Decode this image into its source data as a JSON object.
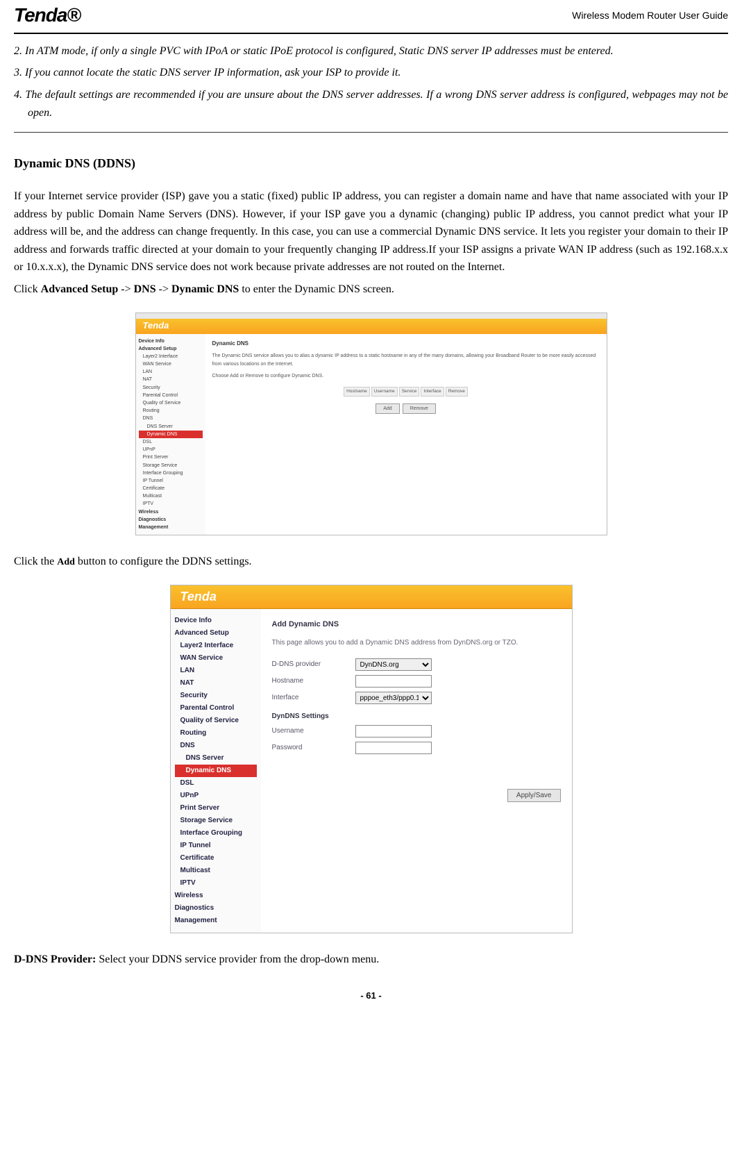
{
  "header": {
    "logo_text": "Tenda®",
    "title": "Wireless Modem Router User Guide"
  },
  "notes": {
    "n2": "2. In ATM mode, if only a single PVC with IPoA or static IPoE protocol is configured, Static DNS server IP addresses must be entered.",
    "n3": "3. If you cannot locate the static DNS server IP information, ask your ISP to provide it.",
    "n4": "4. The default settings are recommended if you are unsure about the DNS server addresses. If a wrong DNS server address is configured, webpages may not be open."
  },
  "section": {
    "heading": "Dynamic DNS (DDNS)",
    "p1": "If your Internet service provider (ISP) gave you a static (fixed) public IP address, you can register a domain name and have that name associated with your IP address by public Domain Name Servers (DNS). However, if your ISP gave you a dynamic (changing) public IP address, you cannot predict what your IP address will be, and the address can change frequently. In this case, you can use a commercial Dynamic DNS service. It lets you register your domain to their IP address and forwards traffic directed at your domain to your frequently changing IP address.If your ISP assigns a private WAN IP address (such as 192.168.x.x or 10.x.x.x), the Dynamic DNS service does not work because private addresses are not routed on the Internet.",
    "p2_pre": "Click ",
    "p2_b1": "Advanced Setup",
    "p2_m1": " -> ",
    "p2_b2": "DNS",
    "p2_m2": " -> ",
    "p2_b3": "Dynamic DNS",
    "p2_post": " to enter the Dynamic DNS screen.",
    "p3_pre": "Click the ",
    "p3_b": "Add",
    "p3_post": " button to configure the DDNS settings.",
    "p4_b": "D-DNS Provider:",
    "p4_post": " Select your DDNS service provider from the drop-down menu."
  },
  "shot1": {
    "logo": "Tenda",
    "sidebar": {
      "device_info": "Device Info",
      "advanced": "Advanced Setup",
      "layer2": "Layer2 Interface",
      "wan": "WAN Service",
      "lan": "LAN",
      "nat": "NAT",
      "security": "Security",
      "parental": "Parental Control",
      "qos": "Quality of Service",
      "routing": "Routing",
      "dns": "DNS",
      "dns_server": "DNS Server",
      "dynamic_dns": "Dynamic DNS",
      "dsl": "DSL",
      "upnp": "UPnP",
      "print": "Print Server",
      "storage": "Storage Service",
      "ifgroup": "Interface Grouping",
      "iptunnel": "IP Tunnel",
      "cert": "Certificate",
      "multicast": "Multicast",
      "iptv": "IPTV",
      "wireless": "Wireless",
      "diag": "Diagnostics",
      "mgmt": "Management"
    },
    "main": {
      "title": "Dynamic DNS",
      "desc1": "The Dynamic DNS service allows you to alias a dynamic IP address to a static hostname in any of the many domains, allowing your Broadband Router to be more easily accessed from various locations on the Internet.",
      "desc2": "Choose Add or Remove to configure Dynamic DNS.",
      "cols": {
        "c1": "Hostname",
        "c2": "Username",
        "c3": "Service",
        "c4": "Interface",
        "c5": "Remove"
      },
      "btn_add": "Add",
      "btn_remove": "Remove"
    }
  },
  "shot2": {
    "logo": "Tenda",
    "sidebar": {
      "device_info": "Device Info",
      "advanced": "Advanced Setup",
      "layer2": "Layer2 Interface",
      "wan": "WAN Service",
      "lan": "LAN",
      "nat": "NAT",
      "security": "Security",
      "parental": "Parental Control",
      "qos": "Quality of Service",
      "routing": "Routing",
      "dns": "DNS",
      "dns_server": "DNS Server",
      "dynamic_dns": "Dynamic DNS",
      "dsl": "DSL",
      "upnp": "UPnP",
      "print": "Print Server",
      "storage": "Storage Service",
      "ifgroup": "Interface Grouping",
      "iptunnel": "IP Tunnel",
      "cert": "Certificate",
      "multicast": "Multicast",
      "iptv": "IPTV",
      "wireless": "Wireless",
      "diag": "Diagnostics",
      "mgmt": "Management"
    },
    "main": {
      "title": "Add Dynamic DNS",
      "desc": "This page allows you to add a Dynamic DNS address from DynDNS.org or TZO.",
      "label_provider": "D-DNS provider",
      "val_provider": "DynDNS.org",
      "label_hostname": "Hostname",
      "label_interface": "Interface",
      "val_interface": "pppoe_eth3/ppp0.1",
      "section_dyndns": "DynDNS Settings",
      "label_user": "Username",
      "label_pass": "Password",
      "btn_apply": "Apply/Save"
    }
  },
  "footer": {
    "page": "- 61 -"
  }
}
